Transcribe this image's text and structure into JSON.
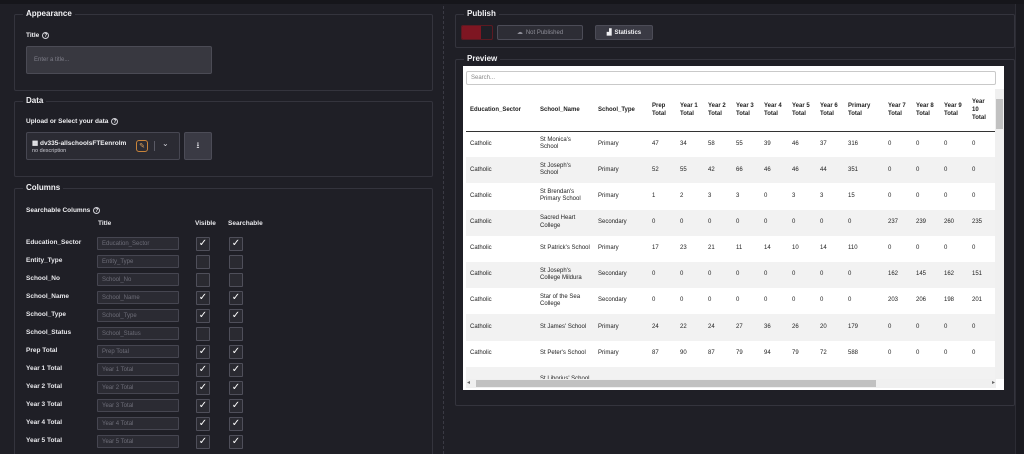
{
  "appearance": {
    "legend": "Appearance",
    "title_label": "Title",
    "title_placeholder": "Enter a title..."
  },
  "data": {
    "legend": "Data",
    "upload_label": "Upload or Select your data",
    "dataset_name": "dv335-allschoolsFTEenrolm",
    "dataset_desc": "no description"
  },
  "columns": {
    "legend": "Columns",
    "searchable_label": "Searchable Columns",
    "head_title": "Title",
    "head_visible": "Visible",
    "head_searchable": "Searchable",
    "rows": [
      {
        "name": "Education_Sector",
        "placeholder": "Education_Sector",
        "visible": true,
        "searchable": true
      },
      {
        "name": "Entity_Type",
        "placeholder": "Entity_Type",
        "visible": false,
        "searchable": false
      },
      {
        "name": "School_No",
        "placeholder": "School_No",
        "visible": false,
        "searchable": false
      },
      {
        "name": "School_Name",
        "placeholder": "School_Name",
        "visible": true,
        "searchable": true
      },
      {
        "name": "School_Type",
        "placeholder": "School_Type",
        "visible": true,
        "searchable": true
      },
      {
        "name": "School_Status",
        "placeholder": "School_Status",
        "visible": false,
        "searchable": false
      },
      {
        "name": "Prep Total",
        "placeholder": "Prep Total",
        "visible": true,
        "searchable": true
      },
      {
        "name": "Year 1 Total",
        "placeholder": "Year 1 Total",
        "visible": true,
        "searchable": true
      },
      {
        "name": "Year 2 Total",
        "placeholder": "Year 2 Total",
        "visible": true,
        "searchable": true
      },
      {
        "name": "Year 3 Total",
        "placeholder": "Year 3 Total",
        "visible": true,
        "searchable": true
      },
      {
        "name": "Year 4 Total",
        "placeholder": "Year 4 Total",
        "visible": true,
        "searchable": true
      },
      {
        "name": "Year 5 Total",
        "placeholder": "Year 5 Total",
        "visible": true,
        "searchable": true
      }
    ]
  },
  "publish": {
    "legend": "Publish",
    "status": "Not Published",
    "stats_button": "Statistics"
  },
  "preview": {
    "legend": "Preview",
    "search_placeholder": "Search...",
    "headers": [
      "Education_Sector",
      "School_Name",
      "School_Type",
      "Prep Total",
      "Year 1 Total",
      "Year 2 Total",
      "Year 3 Total",
      "Year 4 Total",
      "Year 5 Total",
      "Year 6 Total",
      "Primary Total",
      "Year 7 Total",
      "Year 8 Total",
      "Year 9 Total",
      "Year 10 Total"
    ],
    "rows": [
      [
        "Catholic",
        "St Monica's School",
        "Primary",
        "47",
        "34",
        "58",
        "55",
        "39",
        "46",
        "37",
        "316",
        "0",
        "0",
        "0",
        "0"
      ],
      [
        "Catholic",
        "St Joseph's School",
        "Primary",
        "52",
        "55",
        "42",
        "66",
        "46",
        "46",
        "44",
        "351",
        "0",
        "0",
        "0",
        "0"
      ],
      [
        "Catholic",
        "St Brendan's Primary School",
        "Primary",
        "1",
        "2",
        "3",
        "3",
        "0",
        "3",
        "3",
        "15",
        "0",
        "0",
        "0",
        "0"
      ],
      [
        "Catholic",
        "Sacred Heart College",
        "Secondary",
        "0",
        "0",
        "0",
        "0",
        "0",
        "0",
        "0",
        "0",
        "237",
        "239",
        "260",
        "235"
      ],
      [
        "Catholic",
        "St Patrick's School",
        "Primary",
        "17",
        "23",
        "21",
        "11",
        "14",
        "10",
        "14",
        "110",
        "0",
        "0",
        "0",
        "0"
      ],
      [
        "Catholic",
        "St Joseph's College Mildura",
        "Secondary",
        "0",
        "0",
        "0",
        "0",
        "0",
        "0",
        "0",
        "0",
        "162",
        "145",
        "162",
        "151"
      ],
      [
        "Catholic",
        "Star of the Sea College",
        "Secondary",
        "0",
        "0",
        "0",
        "0",
        "0",
        "0",
        "0",
        "0",
        "203",
        "206",
        "198",
        "201"
      ],
      [
        "Catholic",
        "St James' School",
        "Primary",
        "24",
        "22",
        "24",
        "27",
        "36",
        "26",
        "20",
        "179",
        "0",
        "0",
        "0",
        "0"
      ],
      [
        "Catholic",
        "St Peter's School",
        "Primary",
        "87",
        "90",
        "87",
        "79",
        "94",
        "79",
        "72",
        "588",
        "0",
        "0",
        "0",
        "0"
      ],
      [
        "",
        "St Liborius' School",
        "",
        "",
        "",
        "",
        "",
        "",
        "",
        "",
        "",
        "",
        "",
        "",
        ""
      ]
    ]
  }
}
